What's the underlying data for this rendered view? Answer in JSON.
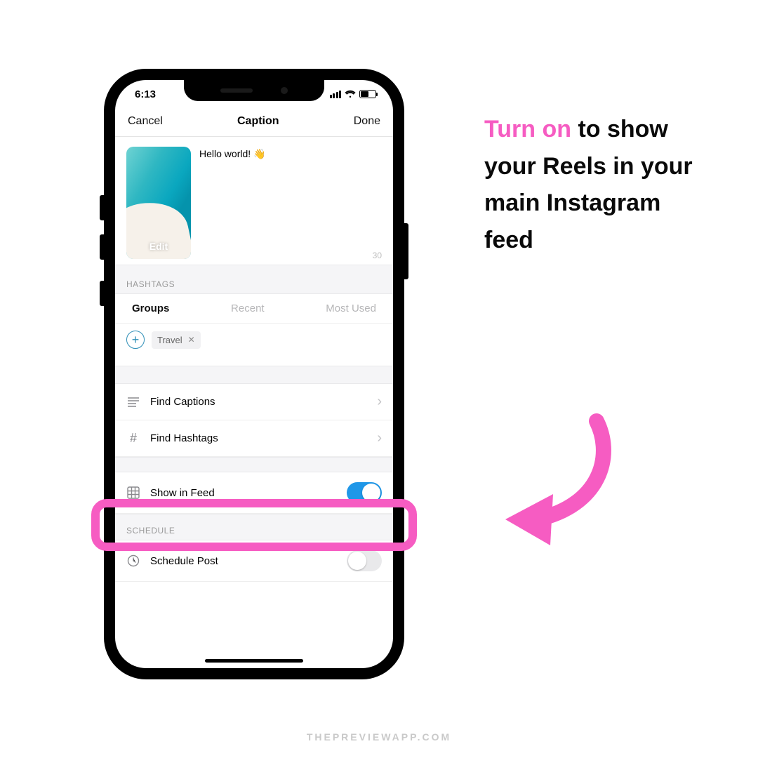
{
  "status": {
    "time": "6:13"
  },
  "nav": {
    "left": "Cancel",
    "title": "Caption",
    "right": "Done"
  },
  "caption": {
    "text": "Hello world! 👋",
    "thumb_label": "Edit",
    "counter": "30"
  },
  "hashtags": {
    "header": "HASHTAGS",
    "tabs": {
      "groups": "Groups",
      "recent": "Recent",
      "most": "Most Used"
    },
    "chip": "Travel"
  },
  "rows": {
    "find_captions": "Find Captions",
    "find_hashtags": "Find Hashtags",
    "show_in_feed": "Show in Feed",
    "schedule_header": "SCHEDULE",
    "schedule_post": "Schedule Post"
  },
  "annotation": {
    "highlight": "Turn on",
    "rest": " to show your Reels in your main Instagram feed"
  },
  "watermark": "THEPREVIEWAPP.COM"
}
